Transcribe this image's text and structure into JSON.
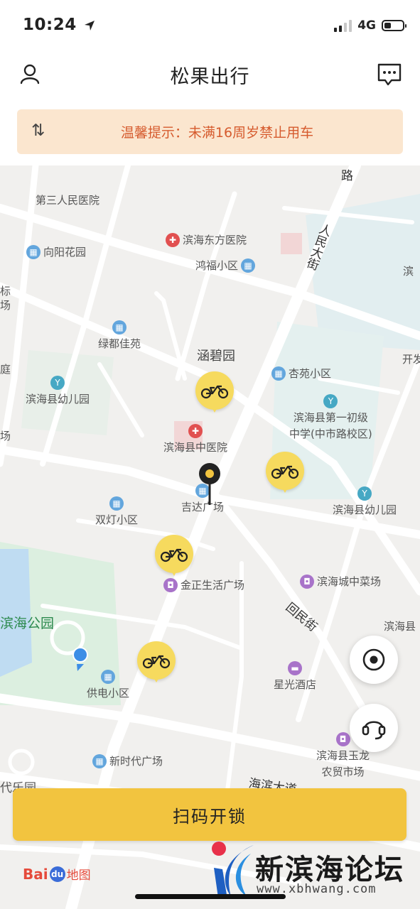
{
  "status_bar": {
    "time": "10:24",
    "network": "4G",
    "battery_level": 0.3
  },
  "nav": {
    "title": "松果出行",
    "left_icon": "user-icon",
    "right_icon": "message-icon"
  },
  "notice": {
    "icon": "⇅",
    "text": "温馨提示：未满16周岁禁止用车"
  },
  "map": {
    "places": {
      "third_hospital": "第三人民医院",
      "dongfang_hospital": "滨海东方医院",
      "xiangyang": "向阳花园",
      "hongfu": "鸿福小区",
      "renmin_street": "人民大街",
      "lvdu": "绿都佳苑",
      "hanbiyuan": "涵碧园",
      "xingyuan": "杏苑小区",
      "kindergarten_west": "滨海县幼儿园",
      "middle_school_1": "滨海县第一初级",
      "middle_school_2": "中学(中市路校区)",
      "tcm_hospital": "滨海县中医院",
      "jida": "吉达广场",
      "kindergarten_east": "滨海县幼儿园",
      "shuangdeng": "双灯小区",
      "jinzheng": "金正生活广场",
      "city_market": "滨海城中菜场",
      "park": "滨海公园",
      "huiminjie": "回民街",
      "gongdian": "供电小区",
      "xingguang": "星光酒店",
      "yulong_1": "滨海县玉龙",
      "yulong_2": "农贸市场",
      "new_era": "新时代广场",
      "haibin_road": "海滨大道",
      "edge_lu": "路",
      "edge_bin": "滨",
      "edge_kaifa": "开发",
      "edge_ting": "庭",
      "edge_chang": "场",
      "edge_binhaixian": "滨海县",
      "edge_daile": "代乐园",
      "edge_biao": "标",
      "edge_chang2": "场"
    },
    "baidu": {
      "bai": "Bai",
      "du": "du",
      "map": "地图"
    }
  },
  "fab": {
    "locate_icon": "locate-icon",
    "service_icon": "headset-icon"
  },
  "scan_button": {
    "label": "扫码开锁"
  },
  "watermark": {
    "title": "新滨海论坛",
    "url": "www.xbhwang.com"
  },
  "colors": {
    "accent": "#f2c43f",
    "bike_marker": "#f6da5e",
    "notice_bg": "#fbe6cf",
    "notice_text": "#d65b2e"
  }
}
